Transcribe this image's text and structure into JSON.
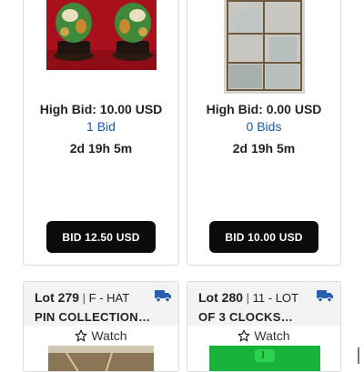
{
  "cards": [
    {
      "image_alt": "Pair of green ceramic foo dogs on red background",
      "high_bid": "High Bid: 10.00 USD",
      "bids": "1 Bid",
      "timer": "2d 19h 5m",
      "button": "BID 12.50 USD"
    },
    {
      "image_alt": "Glass display case",
      "high_bid": "High Bid: 0.00 USD",
      "bids": "0 Bids",
      "timer": "2d 19h 5m",
      "button": "BID 10.00 USD"
    }
  ],
  "lots": [
    {
      "lot_label": "Lot 279",
      "separator": "|",
      "title_line1": "F - HAT",
      "title_line2": "PIN COLLECTION…",
      "watch": "Watch",
      "icon": "truck-icon",
      "thumb_color": "#7a6a4c"
    },
    {
      "lot_label": "Lot 280",
      "separator": "|",
      "title_line1": "11 - LOT",
      "title_line2": "OF 3 CLOCKS…",
      "watch": "Watch",
      "icon": "truck-icon",
      "thumb_color": "#19b23a"
    }
  ],
  "colors": {
    "accent_link": "#1a5aa8",
    "truck": "#2a5fb0",
    "button_bg": "#0b0b0b"
  }
}
